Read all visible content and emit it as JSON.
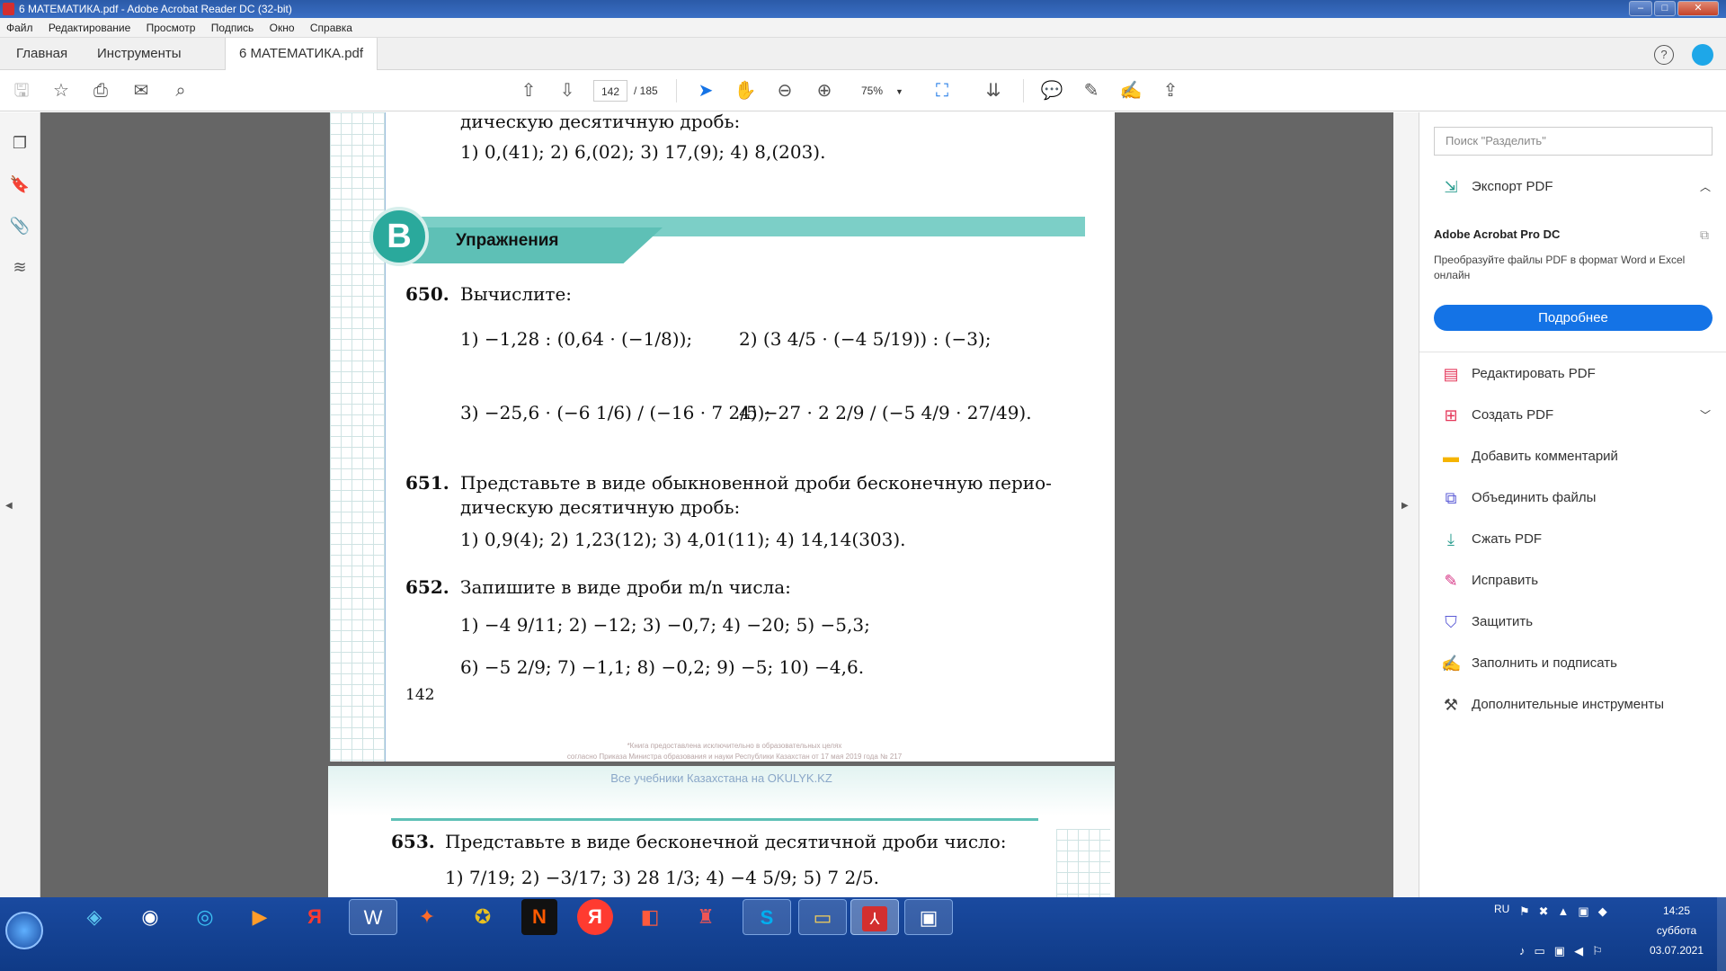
{
  "window": {
    "title": "6 МАТЕМАТИКА.pdf - Adobe Acrobat Reader DC (32-bit)"
  },
  "menu": [
    "Файл",
    "Редактирование",
    "Просмотр",
    "Подпись",
    "Окно",
    "Справка"
  ],
  "tabs": {
    "home": "Главная",
    "tools": "Инструменты",
    "doc": "6 МАТЕМАТИКА.pdf",
    "close": "×"
  },
  "toolbar": {
    "page_current": "142",
    "page_sep": "/ 185",
    "zoom": "75%"
  },
  "doc": {
    "top_line1": "дическую десятичную дробь:",
    "top_line2": "1) 0,(41);      2) 6,(02);      3) 17,(9);      4) 8,(203).",
    "section_letter": "B",
    "section_title": "Упражнения",
    "ex650_num": "650.",
    "ex650_text": "Вычислите:",
    "ex650_1": "1) −1,28 : (0,64 · (−1/8));",
    "ex650_2": "2) (3 4/5 · (−4 5/19)) : (−3);",
    "ex650_3": "3) −25,6 · (−6 1/6) / (−16 · 7 2/5);",
    "ex650_4": "4) −27 · 2 2/9 / (−5 4/9 · 27/49).",
    "ex651_num": "651.",
    "ex651_text1": "Представьте в виде обыкновенной дроби бесконечную перио-",
    "ex651_text2": "дическую десятичную дробь:",
    "ex651_items": "1) 0,9(4);       2) 1,23(12);       3) 4,01(11);     4) 14,14(303).",
    "ex652_num": "652.",
    "ex652_text": "Запишите в виде дроби m/n числа:",
    "ex652_row1": "1) −4 9/11;     2) −12;      3) −0,7;      4) −20;        5) −5,3;",
    "ex652_row2": "6) −5 2/9;      7) −1,1;     8) −0,2;      9) −5;        10) −4,6.",
    "page_number": "142",
    "footer_small1": "*Книга предоставлена исключительно в образовательных целях",
    "footer_small2": "согласно Приказа Министра образования и науки Республики Казахстан от 17 мая 2019 года № 217",
    "footer_site": "Все учебники Казахстана на OKULYK.KZ",
    "ex653_num": "653.",
    "ex653_text": "Представьте в виде бесконечной десятичной дроби число:",
    "ex653_items": "1) 7/19;      2) −3/17;      3) 28 1/3;      4) −4 5/9;      5) 7 2/5."
  },
  "right_panel": {
    "search_placeholder": "Поиск \"Разделить\"",
    "export_pdf": "Экспорт PDF",
    "promo_title": "Adobe Acrobat Pro DC",
    "promo_text": "Преобразуйте файлы PDF в формат Word и Excel онлайн",
    "promo_button": "Подробнее",
    "tools": [
      {
        "label": "Редактировать PDF",
        "color": "#e4385b"
      },
      {
        "label": "Создать PDF",
        "color": "#e4385b"
      },
      {
        "label": "Добавить комментарий",
        "color": "#f5b400"
      },
      {
        "label": "Объединить файлы",
        "color": "#5b5bd6"
      },
      {
        "label": "Сжать PDF",
        "color": "#2a9d8f"
      },
      {
        "label": "Исправить",
        "color": "#d63384"
      },
      {
        "label": "Защитить",
        "color": "#5b5bd6"
      },
      {
        "label": "Заполнить и подписать",
        "color": "#8e44ad"
      },
      {
        "label": "Дополнительные инструменты",
        "color": "#444444"
      }
    ]
  },
  "taskbar": {
    "lang": "RU",
    "time": "14:25",
    "day": "суббота",
    "date": "03.07.2021"
  },
  "colors": {
    "accent_blue": "#1473e6",
    "section_teal": "#7ccfc7"
  }
}
